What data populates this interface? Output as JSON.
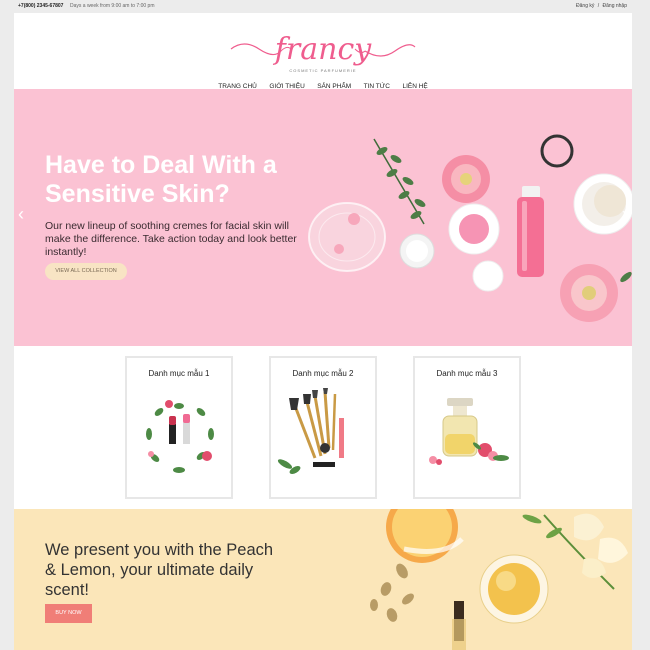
{
  "topbar": {
    "phone": "+7(800) 2345-67807",
    "hours": "Days a week from 9:00 am to 7:00 pm",
    "register": "Đăng ký",
    "separator": "/",
    "login": "Đăng nhập"
  },
  "brand": {
    "logo_text": "francy",
    "tagline": "COSMETIC PARFUMERIE",
    "logo_color": "#ef5d8e"
  },
  "nav": {
    "items": [
      "TRANG CHỦ",
      "GIỚI THIỆU",
      "SẢN PHẨM",
      "TIN TỨC",
      "LIÊN HỆ"
    ]
  },
  "hero": {
    "title": "Have to Deal With a Sensitive Skin?",
    "body": "Our new lineup of soothing cremes for facial skin will make the difference. Take action today and look better instantly!",
    "cta": "VIEW ALL COLLECTION",
    "prev": "‹",
    "next": "›",
    "slide_count": 3,
    "active_slide": 2,
    "bg_color": "#fbc2d3"
  },
  "categories": [
    {
      "title": "Danh mục mẫu 1",
      "image": "lipstick-flatlay"
    },
    {
      "title": "Danh mục mẫu 2",
      "image": "makeup-brushes"
    },
    {
      "title": "Danh mục mẫu 3",
      "image": "oil-bottle"
    }
  ],
  "banner": {
    "title": "We present you with the Peach & Lemon, your ultimate daily scent!",
    "cta": "BUY NOW",
    "bg_color": "#fbe6b9",
    "button_color": "#f07e77"
  }
}
